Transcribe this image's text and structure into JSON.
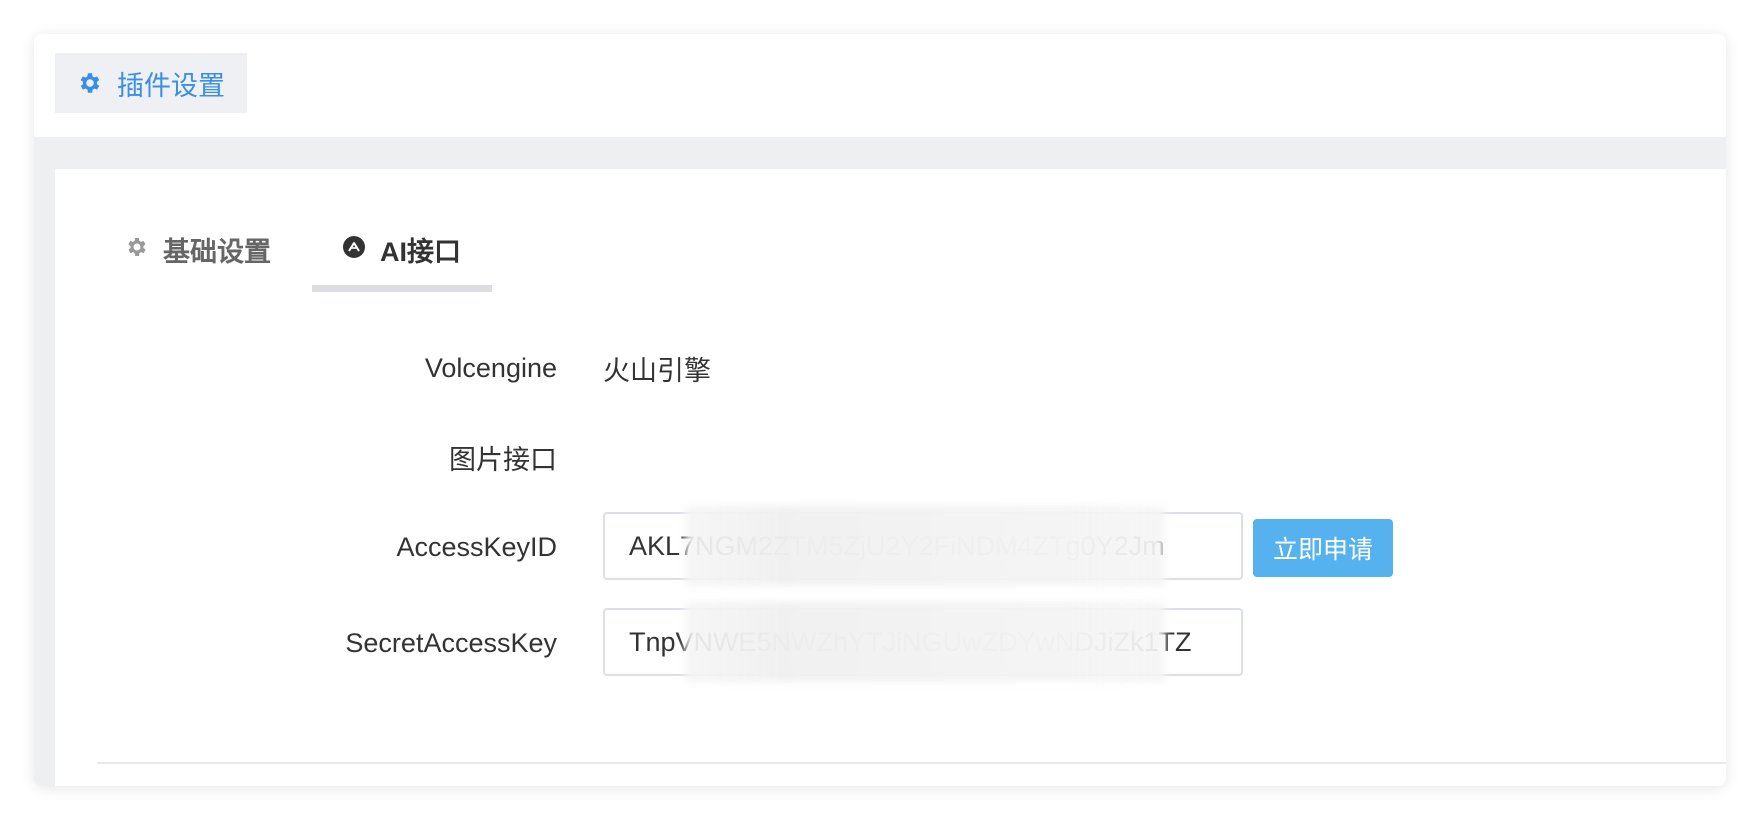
{
  "header": {
    "tab_label": "插件设置",
    "tab_icon": "gear-icon",
    "accent_color": "#3a8ee6"
  },
  "tabs": [
    {
      "label": "基础设置",
      "icon": "gear-icon",
      "active": false
    },
    {
      "label": "AI接口",
      "icon": "ai-circle-icon",
      "active": true
    }
  ],
  "form": {
    "provider": {
      "label": "Volcengine",
      "value": "火山引擎"
    },
    "image_api": {
      "label": "图片接口"
    },
    "access_key_id": {
      "label": "AccessKeyID",
      "value": "AKL7NGM2ZTM5ZjU2Y2FiNDM4ZTg0Y2Jm"
    },
    "secret_access_key": {
      "label": "SecretAccessKey",
      "value": "TnpVNWE5NWZhYTJiNGUwZDYwNDJiZk1TZ"
    },
    "apply_button": "立即申请",
    "button_color": "#55b2ef"
  }
}
